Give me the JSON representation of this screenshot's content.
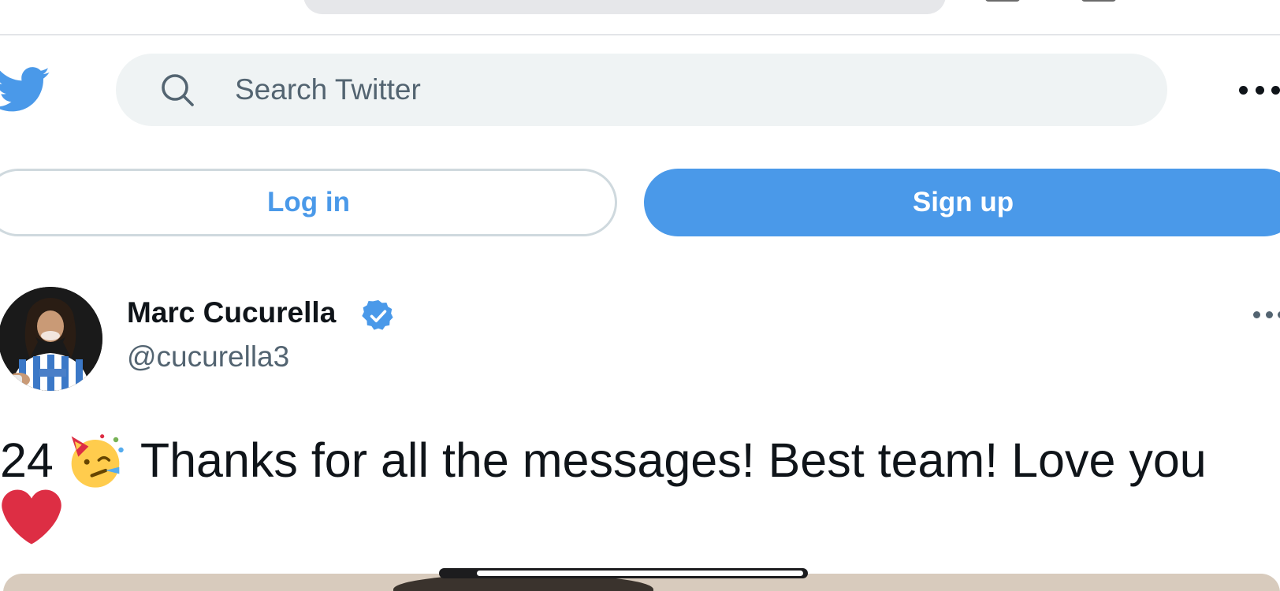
{
  "header": {
    "search": {
      "placeholder": "Search Twitter",
      "value": ""
    }
  },
  "auth": {
    "login_label": "Log in",
    "signup_label": "Sign up"
  },
  "tweet": {
    "author_name": "Marc Cucurella",
    "handle": "@cucurella3",
    "text_prefix": "24",
    "text_main": "Thanks for all the messages! Best team! Love you"
  },
  "colors": {
    "brand_blue": "#4a99e9",
    "text_primary": "#0f1419",
    "text_secondary": "#536471",
    "search_bg": "#eff3f4",
    "heart_red": "#dd2e44"
  },
  "icons": {
    "logo": "twitter-bird-icon",
    "search": "search-icon",
    "more": "more-horizontal-icon",
    "verified": "verified-badge-icon",
    "party": "partying-face-emoji",
    "heart": "red-heart-emoji"
  }
}
